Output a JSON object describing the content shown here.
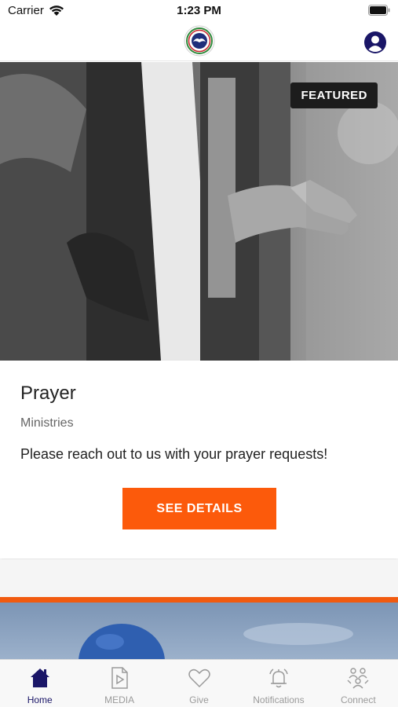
{
  "status_bar": {
    "carrier": "Carrier",
    "time": "1:23 PM"
  },
  "header": {
    "logo_icon": "church-logo-icon",
    "profile_icon": "profile-icon"
  },
  "featured": {
    "badge": "FEATURED",
    "title": "Prayer",
    "category": "Ministries",
    "description": "Please reach out to us with your prayer requests!",
    "button_label": "SEE DETAILS"
  },
  "tabs": [
    {
      "label": "Home",
      "icon": "home-icon",
      "active": true
    },
    {
      "label": "MEDIA",
      "icon": "media-icon",
      "active": false
    },
    {
      "label": "Give",
      "icon": "heart-icon",
      "active": false
    },
    {
      "label": "Notifications",
      "icon": "bell-icon",
      "active": false
    },
    {
      "label": "Connect",
      "icon": "people-icon",
      "active": false
    }
  ],
  "colors": {
    "accent": "#fc5a0b",
    "nav_active": "#1a1667",
    "nav_inactive": "#9a9a9a",
    "badge_bg": "#1c1c1c"
  }
}
